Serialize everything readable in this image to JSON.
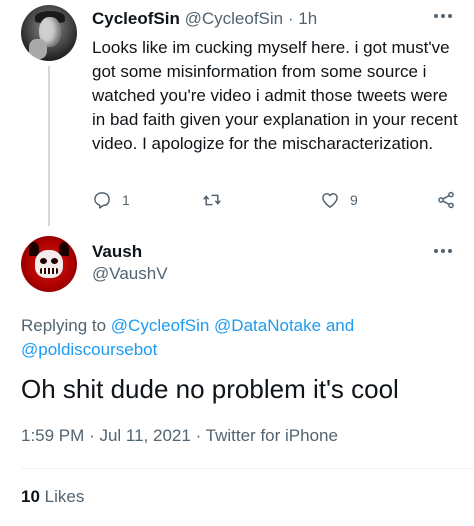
{
  "reply_context_tweet": {
    "display_name": "CycleofSin",
    "handle": "@CycleofSin",
    "separator": "·",
    "time": "1h",
    "text": "Looks like im cucking myself here. i got must've got some misinformation from some source i watched you're video i admit those tweets were in bad faith given your explanation in your recent video. I apologize for the mischaracterization.",
    "reply_count": "1",
    "like_count": "9",
    "icons": {
      "reply": "reply-icon",
      "retweet": "retweet-icon",
      "like": "heart-icon",
      "share": "share-icon",
      "more": "more-icon"
    }
  },
  "main_tweet": {
    "display_name": "Vaush",
    "handle": "@VaushV",
    "replying_prefix": "Replying to",
    "replying_to": [
      "@CycleofSin",
      "@DataNotake",
      "@poldiscoursebot"
    ],
    "replying_joiner": "and",
    "text": "Oh shit dude no problem it's cool",
    "time": "1:59 PM",
    "date": "Jul 11, 2021",
    "meta_separator": "·",
    "source": "Twitter for iPhone",
    "likes_count": "10",
    "likes_label": "Likes"
  },
  "colors": {
    "text_primary": "#0f1419",
    "text_secondary": "#536471",
    "link": "#1d9bf0",
    "thread_line": "#cfd9de",
    "divider": "#eff3f4"
  }
}
